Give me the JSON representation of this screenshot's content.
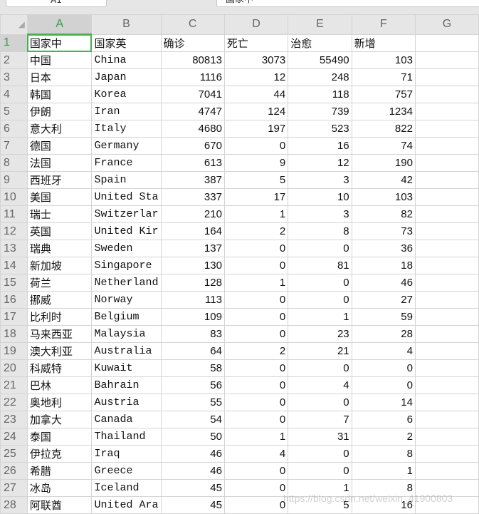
{
  "name_box": "A1",
  "formula_bar": "国家中",
  "columns": [
    "A",
    "B",
    "C",
    "D",
    "E",
    "F",
    "G"
  ],
  "header": [
    "国家中",
    "国家英",
    "确诊",
    "死亡",
    "治愈",
    "新增"
  ],
  "rows": [
    [
      "中国",
      "China",
      80813,
      3073,
      55490,
      103
    ],
    [
      "日本",
      "Japan",
      1116,
      12,
      248,
      71
    ],
    [
      "韩国",
      "Korea",
      7041,
      44,
      118,
      757
    ],
    [
      "伊朗",
      "Iran",
      4747,
      124,
      739,
      1234
    ],
    [
      "意大利",
      "Italy",
      4680,
      197,
      523,
      822
    ],
    [
      "德国",
      "Germany",
      670,
      0,
      16,
      74
    ],
    [
      "法国",
      "France",
      613,
      9,
      12,
      190
    ],
    [
      "西班牙",
      "Spain",
      387,
      5,
      3,
      42
    ],
    [
      "美国",
      "United Sta",
      337,
      17,
      10,
      103
    ],
    [
      "瑞士",
      "Switzerlar",
      210,
      1,
      3,
      82
    ],
    [
      "英国",
      "United Kir",
      164,
      2,
      8,
      73
    ],
    [
      "瑞典",
      "Sweden",
      137,
      0,
      0,
      36
    ],
    [
      "新加坡",
      "Singapore",
      130,
      0,
      81,
      18
    ],
    [
      "荷兰",
      "Netherland",
      128,
      1,
      0,
      46
    ],
    [
      "挪威",
      "Norway",
      113,
      0,
      0,
      27
    ],
    [
      "比利时",
      "Belgium",
      109,
      0,
      1,
      59
    ],
    [
      "马来西亚",
      "Malaysia",
      83,
      0,
      23,
      28
    ],
    [
      "澳大利亚",
      "Australia",
      64,
      2,
      21,
      4
    ],
    [
      "科威特",
      "Kuwait",
      58,
      0,
      0,
      0
    ],
    [
      "巴林",
      "Bahrain",
      56,
      0,
      4,
      0
    ],
    [
      "奥地利",
      "Austria",
      55,
      0,
      0,
      14
    ],
    [
      "加拿大",
      "Canada",
      54,
      0,
      7,
      6
    ],
    [
      "泰国",
      "Thailand",
      50,
      1,
      31,
      2
    ],
    [
      "伊拉克",
      "Iraq",
      46,
      4,
      0,
      8
    ],
    [
      "希腊",
      "Greece",
      46,
      0,
      0,
      1
    ],
    [
      "冰岛",
      "Iceland",
      45,
      0,
      1,
      8
    ],
    [
      "阿联酋",
      "United Ara",
      45,
      0,
      5,
      16
    ]
  ],
  "watermark": "https://blog.csdn.net/weixin_41900803",
  "colors": {
    "selection": "#4caf50",
    "header_bg": "#e6e6e6"
  }
}
